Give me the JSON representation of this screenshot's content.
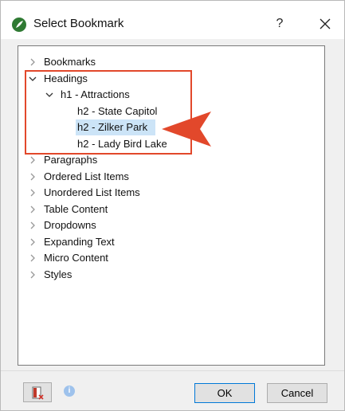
{
  "window": {
    "title": "Select Bookmark",
    "help_label": "?"
  },
  "tree": {
    "items": [
      {
        "label": "Bookmarks",
        "level": 0,
        "expanded": false
      },
      {
        "label": "Headings",
        "level": 0,
        "expanded": true
      },
      {
        "label": "h1 - Attractions",
        "level": 1,
        "expanded": true
      },
      {
        "label": "h2 - State Capitol",
        "level": 2,
        "leaf": true
      },
      {
        "label": "h2 - Zilker Park",
        "level": 2,
        "leaf": true,
        "selected": true
      },
      {
        "label": "h2 - Lady Bird Lake",
        "level": 2,
        "leaf": true
      },
      {
        "label": "Paragraphs",
        "level": 0,
        "expanded": false
      },
      {
        "label": "Ordered List Items",
        "level": 0,
        "expanded": false
      },
      {
        "label": "Unordered List Items",
        "level": 0,
        "expanded": false
      },
      {
        "label": "Table Content",
        "level": 0,
        "expanded": false
      },
      {
        "label": "Dropdowns",
        "level": 0,
        "expanded": false
      },
      {
        "label": "Expanding Text",
        "level": 0,
        "expanded": false
      },
      {
        "label": "Micro Content",
        "level": 0,
        "expanded": false
      },
      {
        "label": "Styles",
        "level": 0,
        "expanded": false
      }
    ]
  },
  "footer": {
    "info_glyph": "i",
    "ok_label": "OK",
    "cancel_label": "Cancel"
  },
  "colors": {
    "selection": "#cce4f7",
    "annotation": "#e2482b",
    "app_icon": "#2f7a33"
  }
}
